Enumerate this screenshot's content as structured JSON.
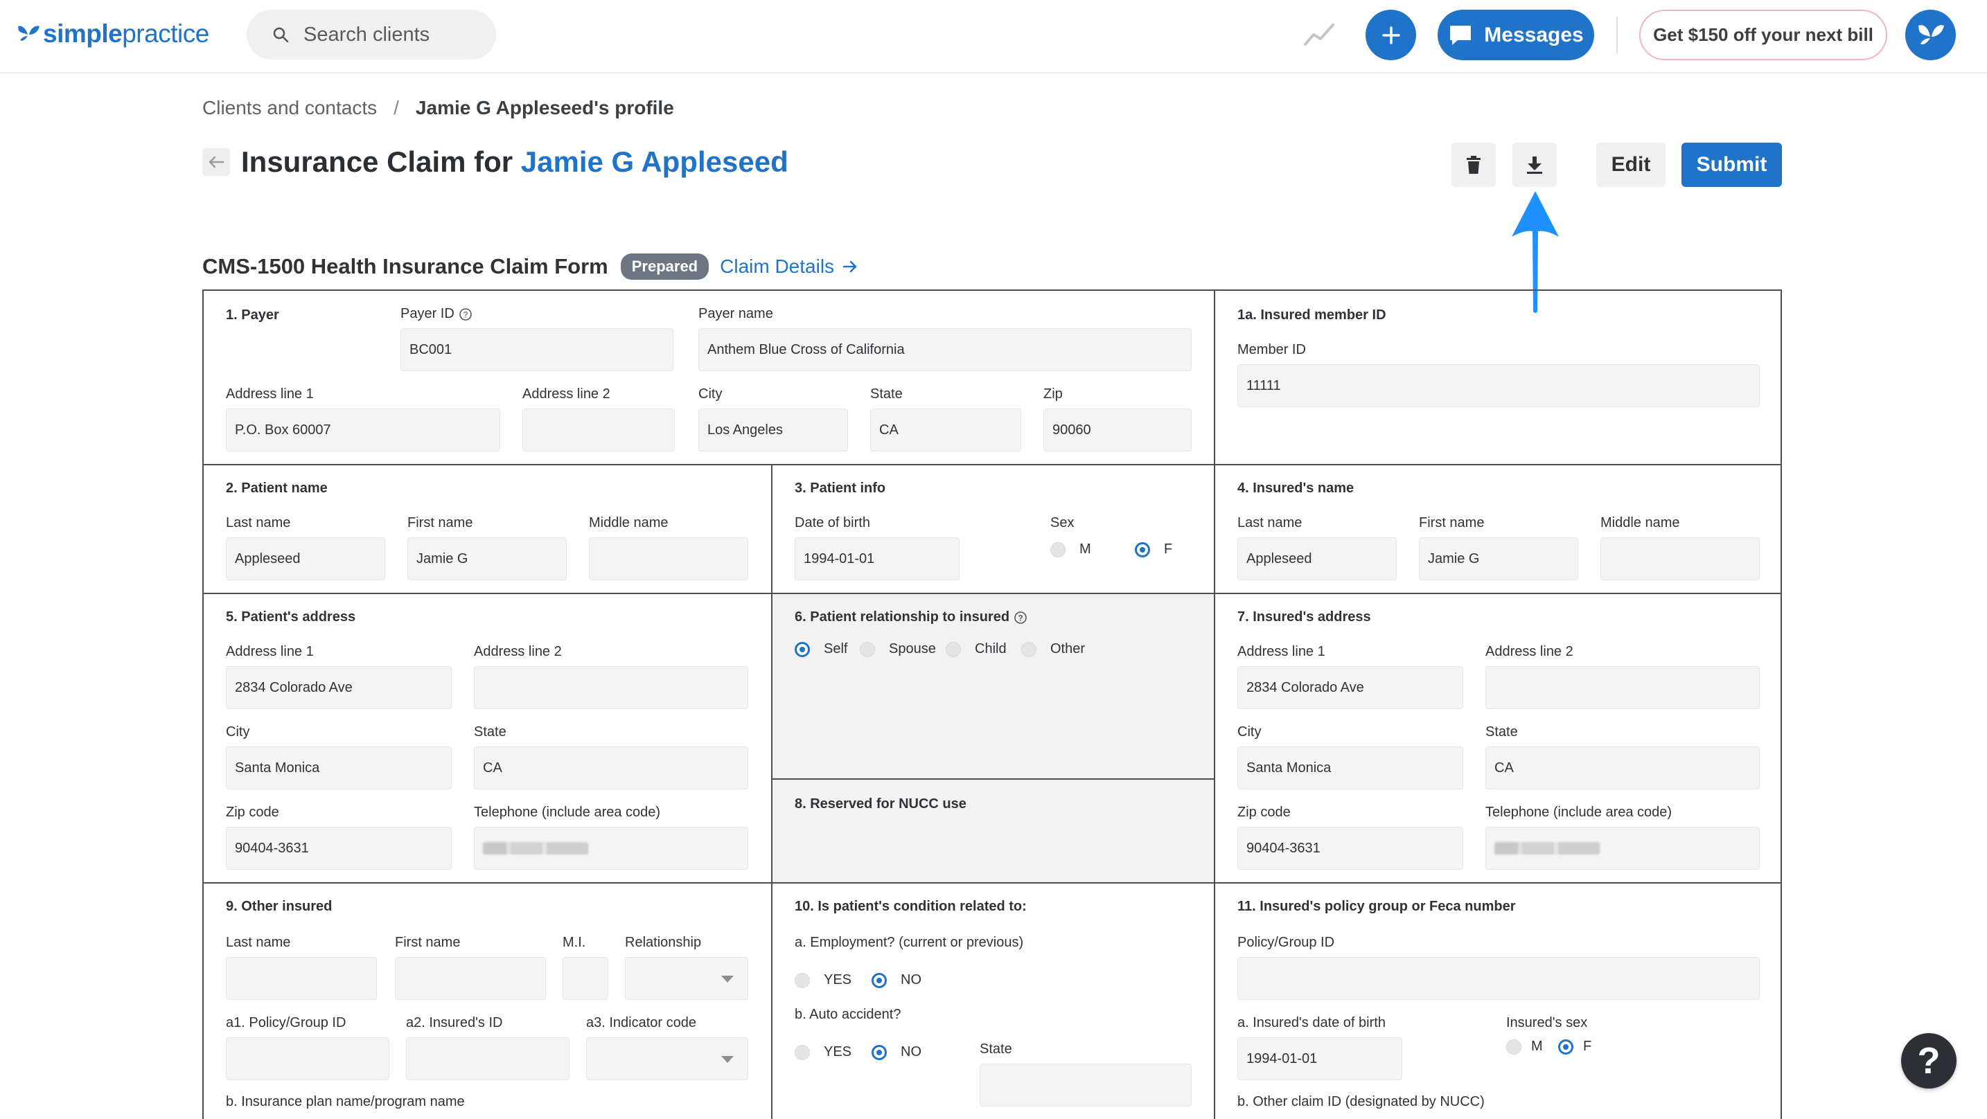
{
  "brand": {
    "logo_bold": "simple",
    "logo_light": "practice"
  },
  "topbar": {
    "search_placeholder": "Search clients",
    "messages_label": "Messages",
    "promo_label": "Get $150 off your next bill"
  },
  "breadcrumb": {
    "parent": "Clients and contacts",
    "separator": "/",
    "current": "Jamie G Appleseed's profile"
  },
  "header": {
    "title_prefix": "Insurance Claim for",
    "client_name": "Jamie G Appleseed",
    "edit_label": "Edit",
    "submit_label": "Submit"
  },
  "form_heading": {
    "title": "CMS-1500 Health Insurance Claim Form",
    "status": "Prepared",
    "details_link": "Claim Details"
  },
  "s1": {
    "title": "1. Payer",
    "payer_id_label": "Payer ID",
    "payer_id": "BC001",
    "payer_name_label": "Payer name",
    "payer_name": "Anthem Blue Cross of California",
    "addr1_label": "Address line 1",
    "addr1": "P.O. Box 60007",
    "addr2_label": "Address line 2",
    "addr2": "",
    "city_label": "City",
    "city": "Los Angeles",
    "state_label": "State",
    "state": "CA",
    "zip_label": "Zip",
    "zip": "90060"
  },
  "s1a": {
    "title": "1a. Insured member ID",
    "member_label": "Member ID",
    "member_id": "11111"
  },
  "s2": {
    "title": "2. Patient name",
    "last_label": "Last name",
    "last": "Appleseed",
    "first_label": "First name",
    "first": "Jamie G",
    "middle_label": "Middle name",
    "middle": ""
  },
  "s3": {
    "title": "3. Patient info",
    "dob_label": "Date of birth",
    "dob": "1994-01-01",
    "sex_label": "Sex",
    "m": "M",
    "f": "F",
    "selected": "F"
  },
  "s4": {
    "title": "4. Insured's name",
    "last_label": "Last name",
    "last": "Appleseed",
    "first_label": "First name",
    "first": "Jamie G",
    "middle_label": "Middle name",
    "middle": ""
  },
  "s5": {
    "title": "5. Patient's address",
    "addr1_label": "Address line 1",
    "addr1": "2834 Colorado Ave",
    "addr2_label": "Address line 2",
    "addr2": "",
    "city_label": "City",
    "city": "Santa Monica",
    "state_label": "State",
    "state": "CA",
    "zip_label": "Zip code",
    "zip": "90404-3631",
    "phone_label": "Telephone (include area code)"
  },
  "s6": {
    "title": "6. Patient relationship to insured",
    "options": [
      "Self",
      "Spouse",
      "Child",
      "Other"
    ],
    "selected": "Self"
  },
  "s7": {
    "title": "7. Insured's address",
    "addr1_label": "Address line 1",
    "addr1": "2834 Colorado Ave",
    "addr2_label": "Address line 2",
    "addr2": "",
    "city_label": "City",
    "city": "Santa Monica",
    "state_label": "State",
    "state": "CA",
    "zip_label": "Zip code",
    "zip": "90404-3631",
    "phone_label": "Telephone (include area code)"
  },
  "s8": {
    "title": "8. Reserved for NUCC use"
  },
  "s9": {
    "title": "9. Other insured",
    "last_label": "Last name",
    "first_label": "First name",
    "mi_label": "M.I.",
    "rel_label": "Relationship",
    "a1_label": "a1. Policy/Group ID",
    "a2_label": "a2. Insured's ID",
    "a3_label": "a3. Indicator code",
    "b_label": "b. Insurance plan name/program name"
  },
  "s10": {
    "title": "10. Is patient's condition related to:",
    "a_label": "a. Employment? (current or previous)",
    "b_label": "b. Auto accident?",
    "yes": "YES",
    "no": "NO",
    "state_label": "State"
  },
  "s11": {
    "title": "11. Insured's policy group or Feca number",
    "policy_label": "Policy/Group ID",
    "policy": "",
    "dob_label": "a. Insured's date of birth",
    "dob": "1994-01-01",
    "sex_label": "Insured's sex",
    "m": "M",
    "f": "F",
    "b_label": "b. Other claim ID (designated by NUCC)"
  },
  "help": {
    "label": "?"
  },
  "colors": {
    "accent": "#1f73c8",
    "badge": "#6b7680",
    "border": "#4b4f53",
    "annotation_arrow": "#1e90ff"
  },
  "icons": [
    "search-icon",
    "trend-icon",
    "plus-icon",
    "chat-icon",
    "butterfly-icon",
    "back-arrow-icon",
    "trash-icon",
    "download-icon",
    "arrow-right-icon",
    "info-icon",
    "help-icon"
  ]
}
